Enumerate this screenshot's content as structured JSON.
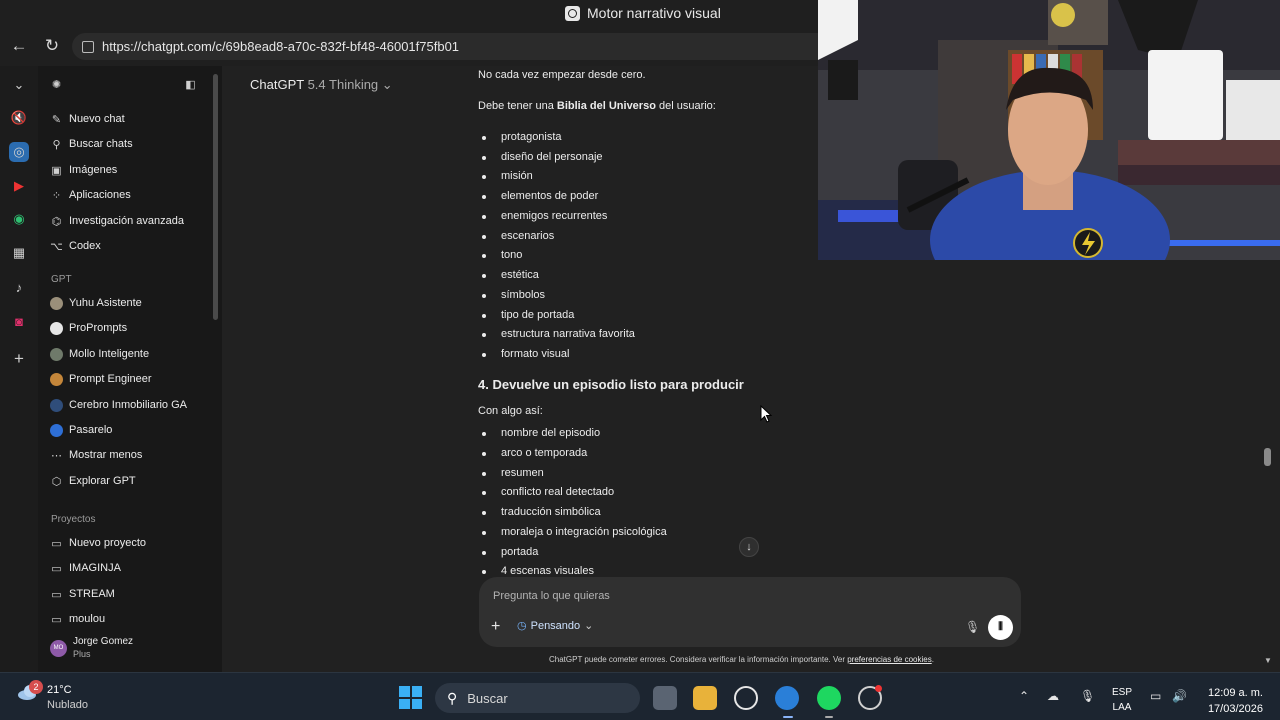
{
  "browser": {
    "tab_title": "Motor narrativo visual",
    "url": "https://chatgpt.com/c/69b8ead8-a70c-832f-bf48-46001f75fb01"
  },
  "sidebar": {
    "items": [
      {
        "label": "Nuevo chat",
        "icon": "edit-icon"
      },
      {
        "label": "Buscar chats",
        "icon": "search-icon"
      },
      {
        "label": "Imágenes",
        "icon": "image-icon"
      },
      {
        "label": "Aplicaciones",
        "icon": "apps-icon"
      },
      {
        "label": "Investigación avanzada",
        "icon": "telescope-icon"
      },
      {
        "label": "Codex",
        "icon": "code-icon"
      }
    ],
    "gpt_section": "GPT",
    "gpts": [
      {
        "label": "Yuhu Asistente",
        "color": "#9a8f7a"
      },
      {
        "label": "ProPrompts",
        "color": "#e6e6e6"
      },
      {
        "label": "Mollo Inteligente",
        "color": "#6f7a6a"
      },
      {
        "label": "Prompt Engineer",
        "color": "#c4863a"
      },
      {
        "label": "Cerebro Inmobiliario GA",
        "color": "#2f4d7a"
      },
      {
        "label": "Pasarelo",
        "color": "#2e6fd6"
      }
    ],
    "show_less": "Mostrar menos",
    "explore": "Explorar GPT",
    "projects_section": "Proyectos",
    "projects": [
      {
        "label": "Nuevo proyecto"
      },
      {
        "label": "IMAGINJA"
      },
      {
        "label": "STREAM"
      },
      {
        "label": "moulou"
      }
    ],
    "user": {
      "name": "Jorge Gomez",
      "plan": "Plus",
      "initials": "MO"
    }
  },
  "header": {
    "model": "ChatGPT",
    "version": "5.4 Thinking"
  },
  "conversation": {
    "line1": "No cada vez empezar desde cero.",
    "line2_prefix": "Debe tener una ",
    "line2_bold": "Biblia del Universo",
    "line2_suffix": " del usuario:",
    "list1": [
      "protagonista",
      "diseño del personaje",
      "misión",
      "elementos de poder",
      "enemigos recurrentes",
      "escenarios",
      "tono",
      "estética",
      "símbolos",
      "tipo de portada",
      "estructura narrativa favorita",
      "formato visual"
    ],
    "heading": "4. Devuelve un episodio listo para producir",
    "intro2": "Con algo así:",
    "list2": [
      "nombre del episodio",
      "arco o temporada",
      "resumen",
      "conflicto real detectado",
      "traducción simbólica",
      "moraleja o integración psicológica",
      "portada",
      "4 escenas visuales"
    ]
  },
  "composer": {
    "placeholder": "Pregunta lo que quieras",
    "thinking_label": "Pensando"
  },
  "disclaimer": {
    "text": "ChatGPT puede cometer errores. Considera verificar la información importante. Ver ",
    "link": "preferencias de cookies",
    "end": "."
  },
  "taskbar": {
    "weather_badge": "2",
    "temperature": "21°C",
    "condition": "Nublado",
    "search_label": "Buscar",
    "lang_top": "ESP",
    "lang_bottom": "LAA",
    "time": "12:09 a. m.",
    "date": "17/03/2026"
  }
}
